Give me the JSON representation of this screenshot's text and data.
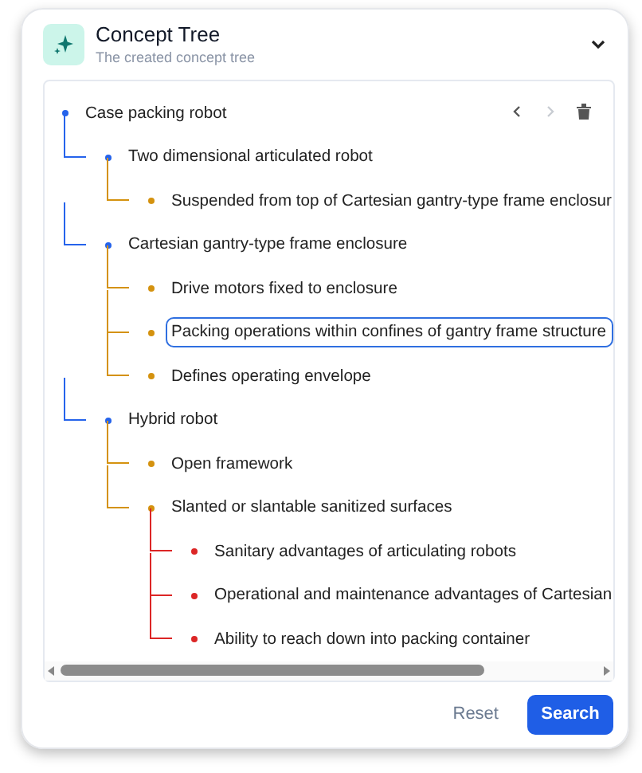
{
  "header": {
    "title": "Concept Tree",
    "subtitle": "The created concept tree",
    "expanded": true
  },
  "toolbar": {
    "prev_disabled": false,
    "next_disabled": true
  },
  "tree": [
    {
      "label": "Case packing robot",
      "selected": false,
      "children": [
        {
          "label": "Two dimensional articulated robot",
          "selected": false,
          "children": [
            {
              "label": "Suspended from top of Cartesian gantry-type frame enclosur",
              "selected": false
            }
          ]
        },
        {
          "label": "Cartesian gantry-type frame enclosure",
          "selected": false,
          "children": [
            {
              "label": "Drive motors fixed to enclosure",
              "selected": false
            },
            {
              "label": "Packing operations within confines of gantry frame structure",
              "selected": true
            },
            {
              "label": "Defines operating envelope",
              "selected": false
            }
          ]
        },
        {
          "label": "Hybrid robot",
          "selected": false,
          "children": [
            {
              "label": "Open framework",
              "selected": false
            },
            {
              "label": "Slanted or slantable sanitized surfaces",
              "selected": false,
              "children": [
                {
                  "label": "Sanitary advantages of articulating robots",
                  "selected": false
                },
                {
                  "label": "Operational and maintenance advantages of Cartesian",
                  "selected": false
                },
                {
                  "label": "Ability to reach down into packing container",
                  "selected": false
                }
              ]
            }
          ]
        }
      ]
    }
  ],
  "buttons": {
    "reset": "Reset",
    "search": "Search"
  }
}
